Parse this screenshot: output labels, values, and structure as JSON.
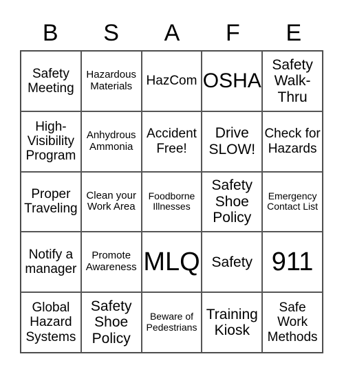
{
  "header": [
    "B",
    "S",
    "A",
    "F",
    "E"
  ],
  "cells": [
    {
      "text": "Safety Meeting",
      "size": "fs-m"
    },
    {
      "text": "Hazardous Materials",
      "size": "fs-s"
    },
    {
      "text": "HazCom",
      "size": "fs-m"
    },
    {
      "text": "OSHA",
      "size": "fs-xl"
    },
    {
      "text": "Safety Walk-Thru",
      "size": "fs-l"
    },
    {
      "text": "High-Visibility Program",
      "size": "fs-m"
    },
    {
      "text": "Anhydrous Ammonia",
      "size": "fs-s"
    },
    {
      "text": "Accident Free!",
      "size": "fs-m"
    },
    {
      "text": "Drive SLOW!",
      "size": "fs-l"
    },
    {
      "text": "Check for Hazards",
      "size": "fs-m"
    },
    {
      "text": "Proper Traveling",
      "size": "fs-m"
    },
    {
      "text": "Clean your Work Area",
      "size": "fs-s"
    },
    {
      "text": "Foodborne Illnesses",
      "size": "fs-st"
    },
    {
      "text": "Safety Shoe Policy",
      "size": "fs-l"
    },
    {
      "text": "Emergency Contact List",
      "size": "fs-st"
    },
    {
      "text": "Notify a manager",
      "size": "fs-m"
    },
    {
      "text": "Promote Awareness",
      "size": "fs-s"
    },
    {
      "text": "MLQ",
      "size": "fs-xxl"
    },
    {
      "text": "Safety",
      "size": "fs-l"
    },
    {
      "text": "911",
      "size": "fs-xxl"
    },
    {
      "text": "Global Hazard Systems",
      "size": "fs-m"
    },
    {
      "text": "Safety Shoe Policy",
      "size": "fs-l"
    },
    {
      "text": "Beware of Pedestrians",
      "size": "fs-st"
    },
    {
      "text": "Training Kiosk",
      "size": "fs-l"
    },
    {
      "text": "Safe Work Methods",
      "size": "fs-m"
    }
  ]
}
